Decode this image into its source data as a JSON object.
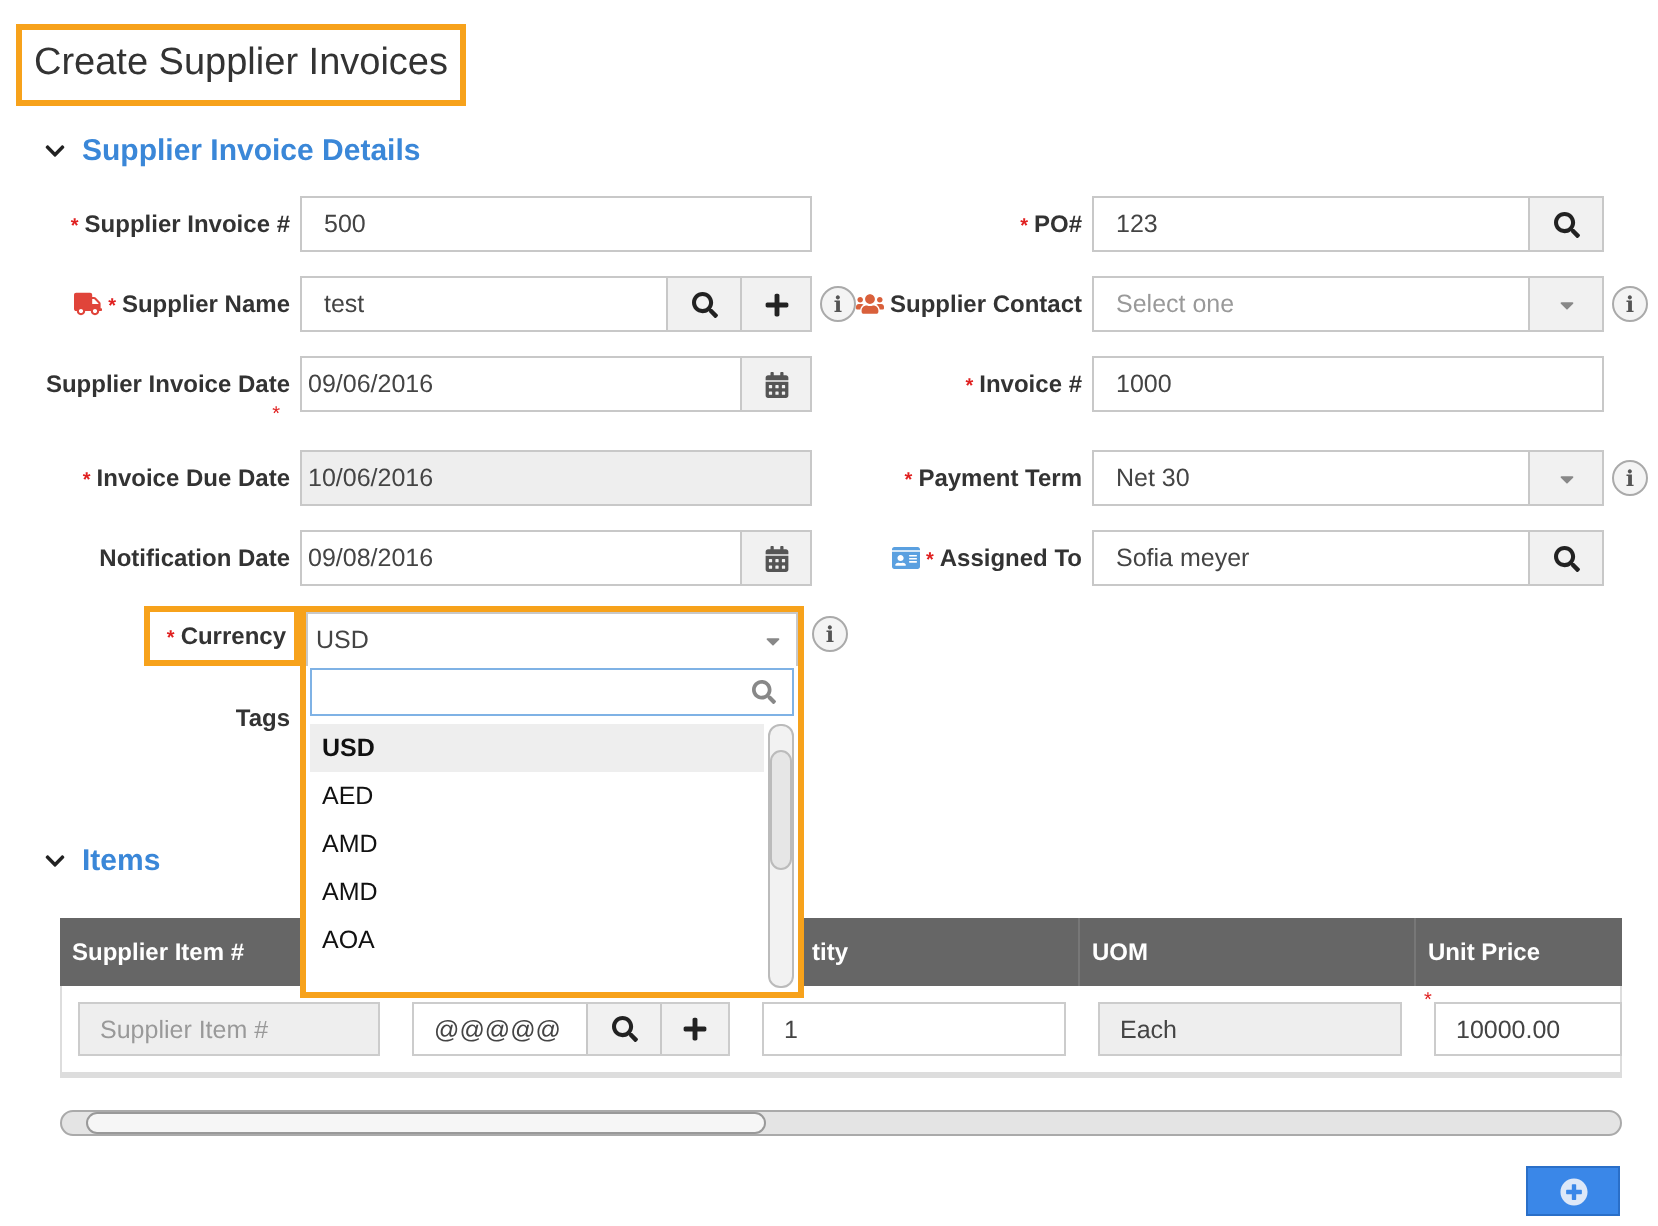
{
  "title": "Create Supplier Invoices",
  "section": {
    "label": "Supplier Invoice Details",
    "expanded": true
  },
  "rows": [
    {
      "left": {
        "label": "Supplier Invoice #",
        "required": "*",
        "kind": "text",
        "value": "500"
      },
      "right": {
        "label": "PO#",
        "required": "*",
        "kind": "lookup",
        "value": "123"
      }
    },
    {
      "left": {
        "label": "Supplier Name",
        "required": "*",
        "kind": "lookup_add",
        "value": "test",
        "info": "i"
      },
      "right": {
        "label": "Supplier Contact",
        "kind": "select",
        "placeholder": "Select one",
        "info": "i"
      }
    },
    {
      "left": {
        "label": "Supplier Invoice Date",
        "required_below": "*",
        "kind": "date",
        "value": "09/06/2016"
      },
      "right": {
        "label": "Invoice #",
        "required": "*",
        "kind": "text",
        "value": "1000"
      }
    },
    {
      "left": {
        "label": "Invoice Due Date",
        "required": "*",
        "kind": "readonly",
        "value": "10/06/2016"
      },
      "right": {
        "label": "Payment Term",
        "required": "*",
        "kind": "select",
        "value": "Net 30",
        "info": "i"
      }
    },
    {
      "left": {
        "label": "Notification Date",
        "kind": "date",
        "value": "09/08/2016"
      },
      "right": {
        "label": "Assigned To",
        "required": "*",
        "kind": "lookup",
        "value": "Sofia meyer"
      }
    }
  ],
  "currency": {
    "label": "Currency",
    "required": "*",
    "value": "USD",
    "info": "i",
    "highlighted": true,
    "options": [
      {
        "label": "USD",
        "selected": true
      },
      {
        "label": "AED",
        "selected": false
      },
      {
        "label": "AMD",
        "selected": false
      },
      {
        "label": "AMD",
        "selected": false
      },
      {
        "label": "AOA",
        "selected": false
      }
    ]
  },
  "tags": {
    "label": "Tags"
  },
  "items": {
    "label": "Items",
    "expanded": true,
    "columns": [
      "Supplier Item #",
      "tity",
      "UOM",
      "Unit Price"
    ],
    "row": {
      "supplier_item_placeholder": "Supplier Item #",
      "item": "@@@@@",
      "quantity": "1",
      "uom": "Each",
      "unit_price": "10000.00",
      "unit_price_required": "*"
    }
  }
}
